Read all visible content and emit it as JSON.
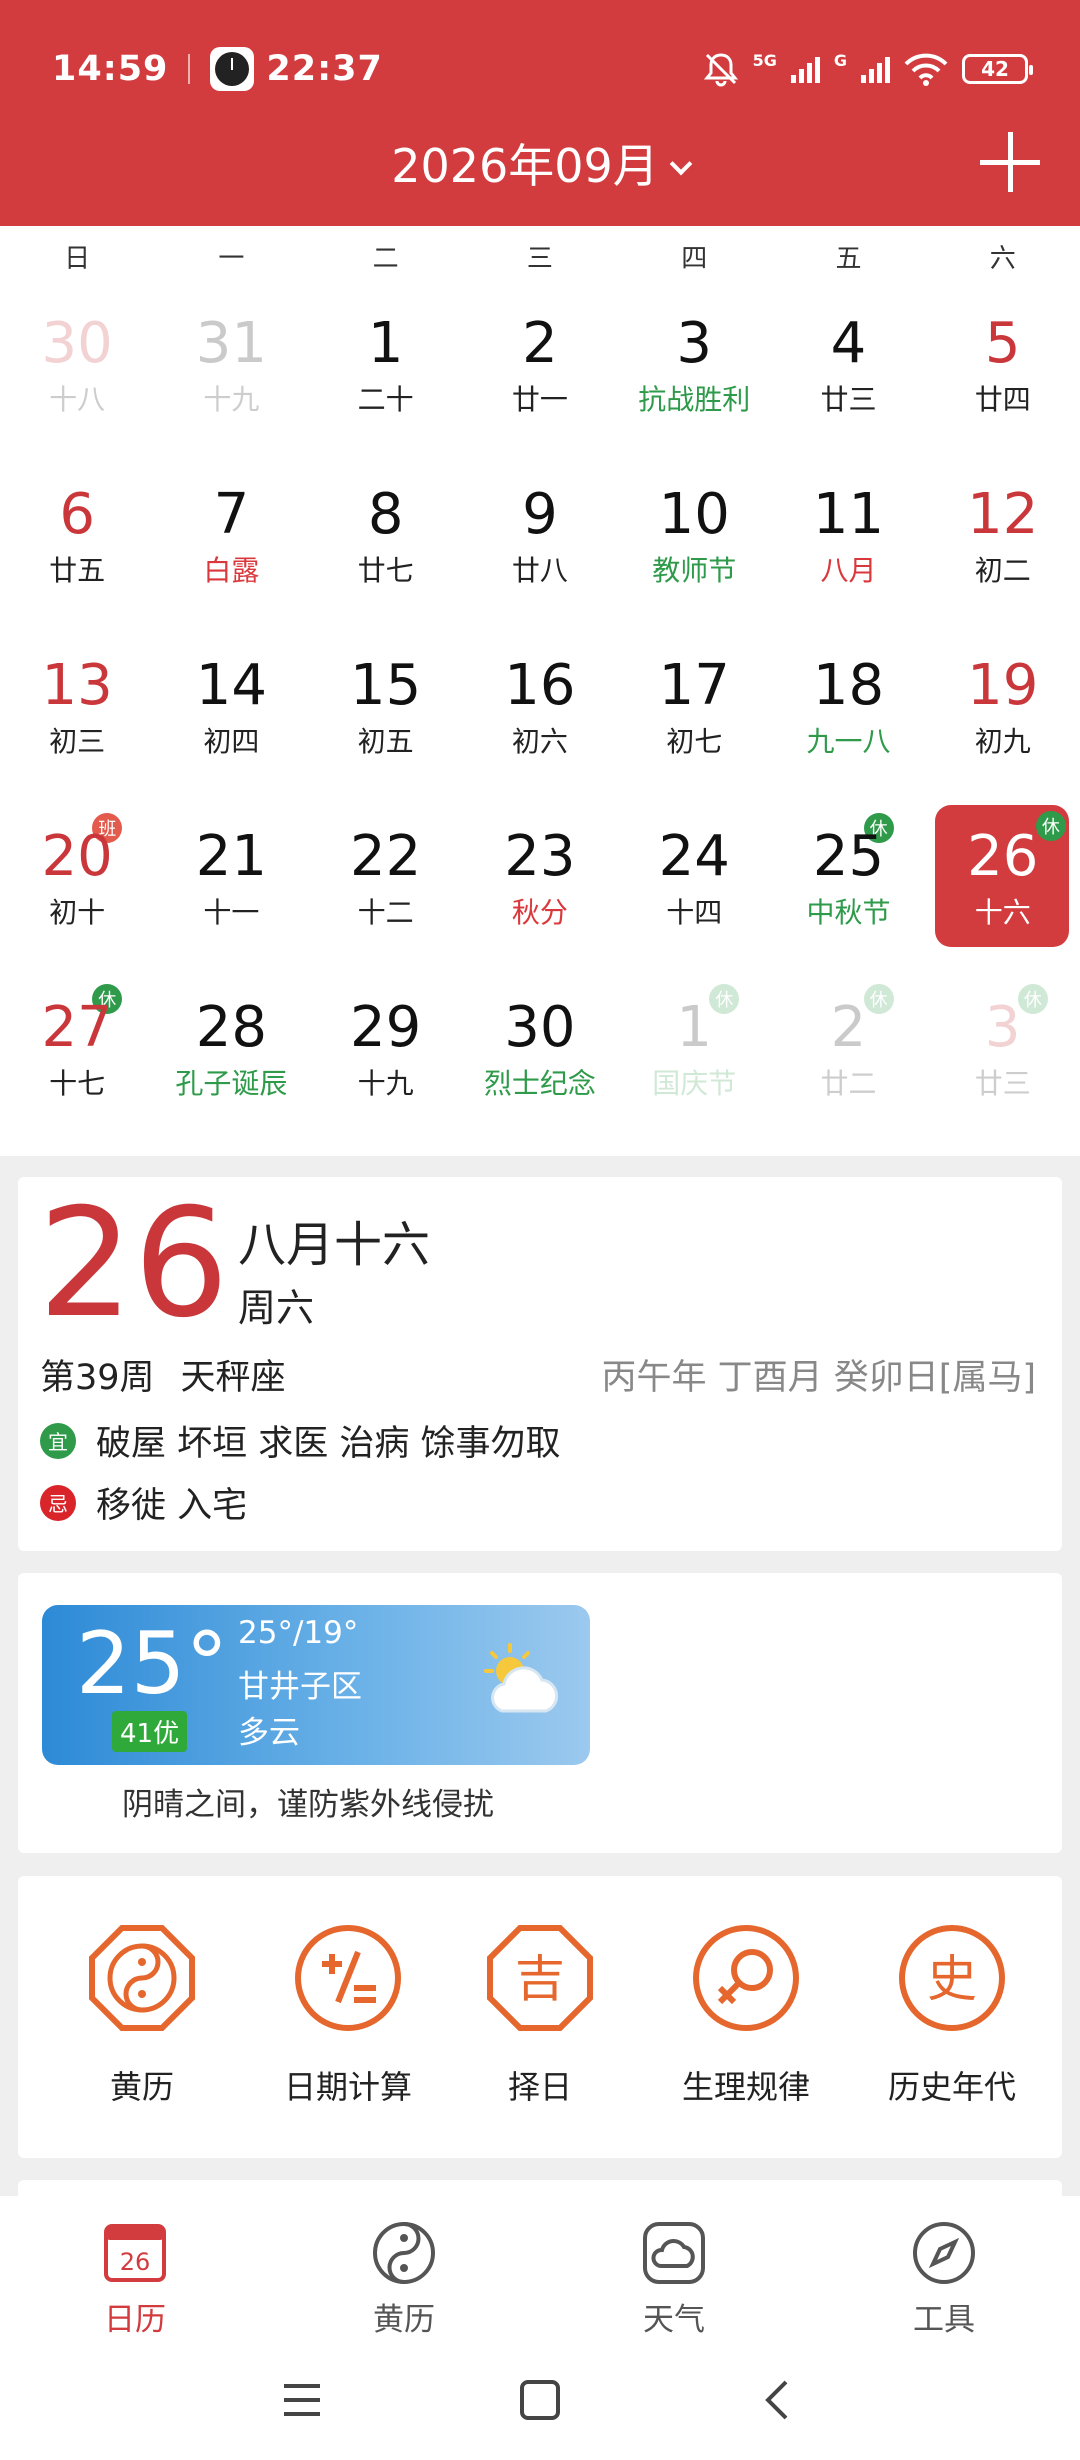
{
  "status": {
    "time": "14:59",
    "clock_time": "22:37",
    "network": "5G",
    "network2": "G",
    "battery": "42"
  },
  "header": {
    "month_title": "2026年09月"
  },
  "weekdays": [
    "日",
    "一",
    "二",
    "三",
    "四",
    "五",
    "六"
  ],
  "days": [
    {
      "d": "30",
      "l": "十八"
    },
    {
      "d": "31",
      "l": "十九"
    },
    {
      "d": "1",
      "l": "二十"
    },
    {
      "d": "2",
      "l": "廿一"
    },
    {
      "d": "3",
      "l": "抗战胜利"
    },
    {
      "d": "4",
      "l": "廿三"
    },
    {
      "d": "5",
      "l": "廿四"
    },
    {
      "d": "6",
      "l": "廿五"
    },
    {
      "d": "7",
      "l": "白露"
    },
    {
      "d": "8",
      "l": "廿七"
    },
    {
      "d": "9",
      "l": "廿八"
    },
    {
      "d": "10",
      "l": "教师节"
    },
    {
      "d": "11",
      "l": "八月"
    },
    {
      "d": "12",
      "l": "初二"
    },
    {
      "d": "13",
      "l": "初三"
    },
    {
      "d": "14",
      "l": "初四"
    },
    {
      "d": "15",
      "l": "初五"
    },
    {
      "d": "16",
      "l": "初六"
    },
    {
      "d": "17",
      "l": "初七"
    },
    {
      "d": "18",
      "l": "九一八"
    },
    {
      "d": "19",
      "l": "初九"
    },
    {
      "d": "20",
      "l": "初十"
    },
    {
      "d": "21",
      "l": "十一"
    },
    {
      "d": "22",
      "l": "十二"
    },
    {
      "d": "23",
      "l": "秋分"
    },
    {
      "d": "24",
      "l": "十四"
    },
    {
      "d": "25",
      "l": "中秋节"
    },
    {
      "d": "26",
      "l": "十六"
    },
    {
      "d": "27",
      "l": "十七"
    },
    {
      "d": "28",
      "l": "孔子诞辰"
    },
    {
      "d": "29",
      "l": "十九"
    },
    {
      "d": "30",
      "l": "烈士纪念"
    },
    {
      "d": "1",
      "l": "国庆节"
    },
    {
      "d": "2",
      "l": "廿二"
    },
    {
      "d": "3",
      "l": "廿三"
    }
  ],
  "tags": {
    "rest": "休",
    "work": "班"
  },
  "detail": {
    "day": "26",
    "lunar": "八月十六",
    "weekday": "周六",
    "week_no": "第39周",
    "zodiac": "天秤座",
    "ganzhi": "丙午年 丁酉月 癸卯日[属马]",
    "yi_label": "宜",
    "yi": "破屋 坏垣 求医 治病 馀事勿取",
    "ji_label": "忌",
    "ji": "移徙 入宅"
  },
  "weather": {
    "temp": "25°",
    "aqi": "41优",
    "range": "25°/19°",
    "area": "甘井子区",
    "condition": "多云",
    "tip": "阴晴之间，谨防紫外线侵扰",
    "icon": "partly-cloudy-icon"
  },
  "tools": [
    {
      "label": "黄历",
      "icon": "yinyang-icon"
    },
    {
      "label": "日期计算",
      "icon": "calculator-icon"
    },
    {
      "label": "择日",
      "icon": "ji-icon"
    },
    {
      "label": "生理规律",
      "icon": "female-icon"
    },
    {
      "label": "历史年代",
      "icon": "history-icon"
    }
  ],
  "nav": [
    {
      "label": "日历",
      "icon_text": "26",
      "active": true
    },
    {
      "label": "黄历"
    },
    {
      "label": "天气"
    },
    {
      "label": "工具"
    }
  ],
  "colors": {
    "accent": "#d23c3f",
    "green": "#2e9a4a",
    "orange": "#e5672d"
  }
}
